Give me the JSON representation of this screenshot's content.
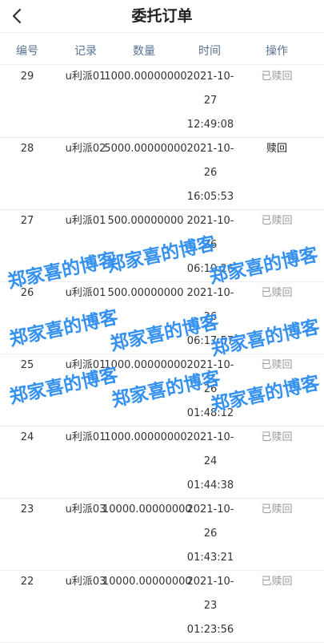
{
  "header": {
    "title": "委托订单",
    "back_icon": "chevron-left-icon"
  },
  "columns": [
    "编号",
    "记录",
    "数量",
    "时间",
    "操作"
  ],
  "rows": [
    {
      "id": "29",
      "record": "u利派01",
      "amount": "1000.00000000",
      "date1": "2021-10-",
      "date2": "27",
      "time": "12:49:08",
      "action": "已赎回",
      "status": "done"
    },
    {
      "id": "28",
      "record": "u利派02",
      "amount": "5000.00000000",
      "date1": "2021-10-",
      "date2": "26",
      "time": "16:05:53",
      "action": "赎回",
      "status": "active"
    },
    {
      "id": "27",
      "record": "u利派01",
      "amount": "500.00000000",
      "date1": "2021-10-",
      "date2": "26",
      "time": "06:19:26",
      "action": "已赎回",
      "status": "done"
    },
    {
      "id": "26",
      "record": "u利派01",
      "amount": "500.00000000",
      "date1": "2021-10-",
      "date2": "26",
      "time": "06:17:57",
      "action": "已赎回",
      "status": "done"
    },
    {
      "id": "25",
      "record": "u利派01",
      "amount": "1000.00000000",
      "date1": "2021-10-",
      "date2": "26",
      "time": "01:48:12",
      "action": "已赎回",
      "status": "done"
    },
    {
      "id": "24",
      "record": "u利派01",
      "amount": "1000.00000000",
      "date1": "2021-10-",
      "date2": "24",
      "time": "01:44:38",
      "action": "已赎回",
      "status": "done"
    },
    {
      "id": "23",
      "record": "u利派03",
      "amount": "10000.00000000",
      "date1": "2021-10-",
      "date2": "26",
      "time": "01:43:21",
      "action": "已赎回",
      "status": "done"
    },
    {
      "id": "22",
      "record": "u利派03",
      "amount": "10000.00000000",
      "date1": "2021-10-",
      "date2": "23",
      "time": "01:23:56",
      "action": "已赎回",
      "status": "done"
    }
  ],
  "watermark": {
    "text": "郑家喜的博客",
    "color": "#2a8cf0"
  }
}
